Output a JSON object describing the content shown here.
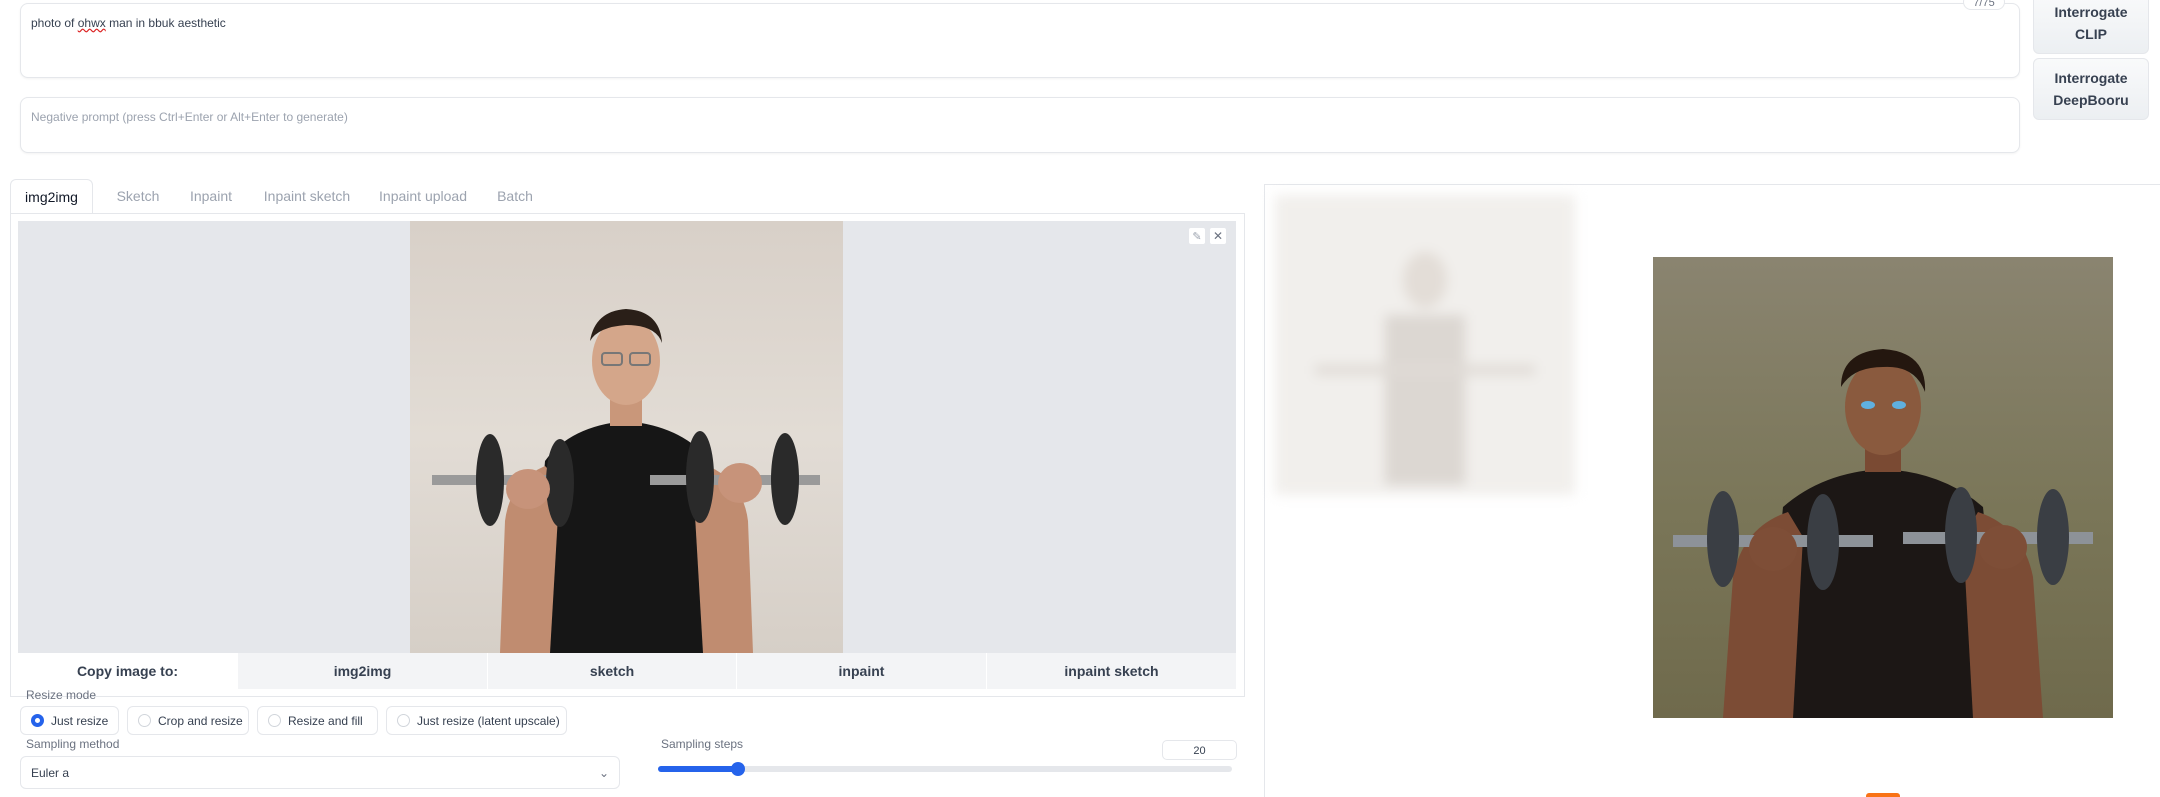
{
  "prompt": {
    "value": "photo of ohwx man in bbuk aesthetic",
    "misspelled_word": "ohwx",
    "token_count": "7/75"
  },
  "negative_prompt": {
    "placeholder": "Negative prompt (press Ctrl+Enter or Alt+Enter to generate)"
  },
  "side_buttons": {
    "interrogate_clip": "Interrogate CLIP",
    "interrogate_deepbooru": "Interrogate DeepBooru"
  },
  "tabs": [
    {
      "label": "img2img",
      "active": true
    },
    {
      "label": "Sketch",
      "active": false
    },
    {
      "label": "Inpaint",
      "active": false
    },
    {
      "label": "Inpaint sketch",
      "active": false
    },
    {
      "label": "Inpaint upload",
      "active": false
    },
    {
      "label": "Batch",
      "active": false
    }
  ],
  "copy_image": {
    "label": "Copy image to:",
    "targets": [
      "img2img",
      "sketch",
      "inpaint",
      "inpaint sketch"
    ]
  },
  "resize_mode": {
    "label": "Resize mode",
    "options": [
      "Just resize",
      "Crop and resize",
      "Resize and fill",
      "Just resize (latent upscale)"
    ],
    "selected": "Just resize"
  },
  "sampling_method": {
    "label": "Sampling method",
    "value": "Euler a"
  },
  "sampling_steps": {
    "label": "Sampling steps",
    "value": "20",
    "fraction": 0.14
  },
  "colors": {
    "accent": "#2563eb",
    "progress": "#f97316"
  }
}
